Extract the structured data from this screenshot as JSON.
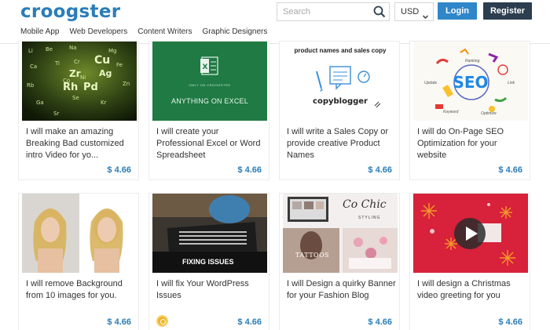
{
  "header": {
    "logo": "croogster",
    "search_placeholder": "Search",
    "currency": "USD",
    "login_label": "Login",
    "register_label": "Register"
  },
  "nav": [
    {
      "label": "Mobile App"
    },
    {
      "label": "Web Developers"
    },
    {
      "label": "Content Writers"
    },
    {
      "label": "Graphic Designers"
    }
  ],
  "thumb_text": {
    "excel": "ANYTHING ON EXCEL",
    "excel_small": "ONLY ON CROOGSTER",
    "copy_top": "product names and sales copy",
    "copy_brand": "copyblogger",
    "seo": "SEO",
    "seo_words": [
      "Keyword",
      "Optimize",
      "Update",
      "Link",
      "Ranking"
    ],
    "wp": "FIXING ISSUES",
    "blog_sig": "Co Chic",
    "blog_sub": "STYLING",
    "tattoos": "TATTOOS"
  },
  "cards": [
    {
      "title": "I will make an amazing Breaking Bad customized intro Video for yo...",
      "price": "$ 4.66"
    },
    {
      "title": "I will create your Professional Excel or Word Spreadsheet",
      "price": "$ 4.66"
    },
    {
      "title": "I will write a Sales Copy or provide creative Product Names",
      "price": "$ 4.66"
    },
    {
      "title": "I will do On-Page SEO Optimization for your website",
      "price": "$ 4.66"
    },
    {
      "title": "I will remove Background from 10 images for you.",
      "price": "$ 4.66"
    },
    {
      "title": "I will fix Your WordPress Issues",
      "price": "$ 4.66"
    },
    {
      "title": "I will Design a quirky Banner for your Fashion Blog",
      "price": "$ 4.66"
    },
    {
      "title": "I will design a Christmas video greeting for you",
      "price": "$ 4.66"
    }
  ],
  "colors": {
    "brand": "#2a7db8",
    "login": "#2f86c8",
    "register": "#2c3e4f",
    "excel_green": "#1f7a43",
    "xmas_red": "#d8213a"
  }
}
